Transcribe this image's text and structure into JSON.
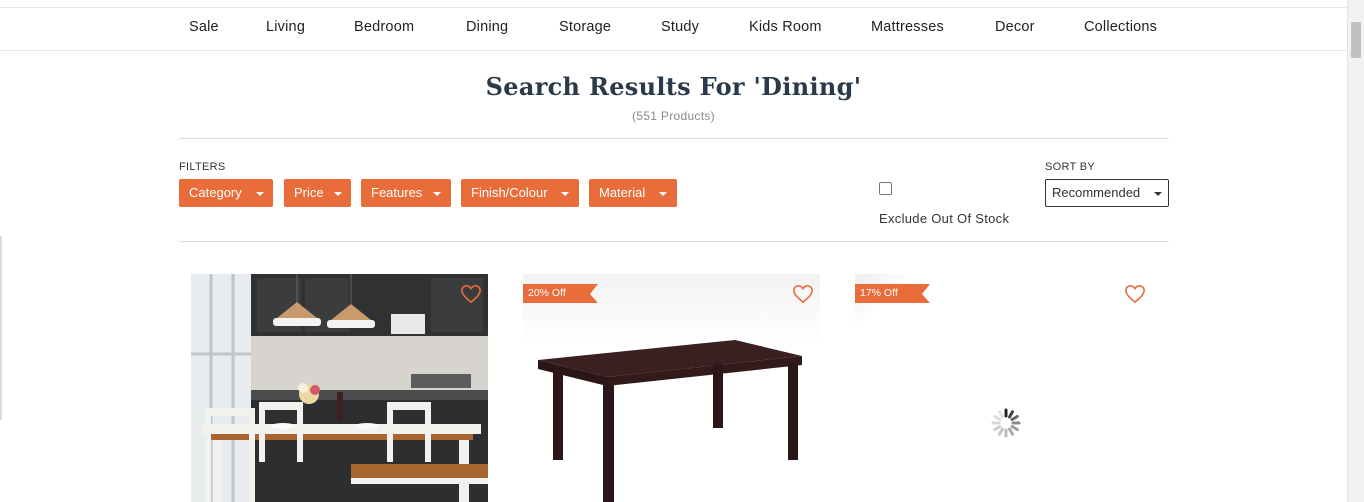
{
  "nav": {
    "items": [
      "Sale",
      "Living",
      "Bedroom",
      "Dining",
      "Storage",
      "Study",
      "Kids Room",
      "Mattresses",
      "Decor",
      "Collections"
    ]
  },
  "search": {
    "title": "Search Results For 'Dining'",
    "count": "(551 Products)"
  },
  "filters": {
    "label": "FILTERS",
    "buttons": [
      "Category",
      "Price",
      "Features",
      "Finish/Colour",
      "Material"
    ]
  },
  "stock": {
    "label": "Exclude Out Of Stock",
    "checked": false
  },
  "sort": {
    "label": "SORT BY",
    "selected": "Recommended"
  },
  "products": [
    {
      "badge": "",
      "image": "dining-set-photo"
    },
    {
      "badge": "20% Off",
      "image": "dining-table-photo"
    },
    {
      "badge": "17% Off",
      "image": "loading-spinner"
    }
  ],
  "colors": {
    "accent": "#e86d3b",
    "title": "#2b3a4a"
  }
}
